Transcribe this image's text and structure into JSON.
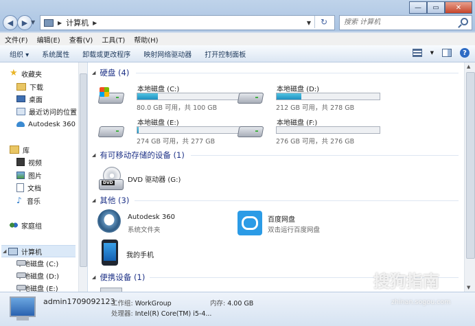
{
  "address": {
    "path": "计算机",
    "search_placeholder": "搜索 计算机"
  },
  "menu": [
    "文件(F)",
    "编辑(E)",
    "查看(V)",
    "工具(T)",
    "帮助(H)"
  ],
  "commands": [
    "组织 ▾",
    "系统属性",
    "卸载或更改程序",
    "映射网络驱动器",
    "打开控制面板"
  ],
  "nav": {
    "favorites": "收藏夹",
    "fav_items": [
      "下载",
      "桌面",
      "最近访问的位置",
      "Autodesk 360"
    ],
    "library": "库",
    "lib_items": [
      "视频",
      "图片",
      "文档",
      "音乐"
    ],
    "homegroup": "家庭组",
    "computer": "计算机",
    "computer_items": [
      "本地磁盘 (C:)",
      "本地磁盘 (D:)",
      "本地磁盘 (E:)"
    ]
  },
  "groups": {
    "hard_disks": "硬盘 (4)",
    "removable": "有可移动存储的设备 (1)",
    "other": "其他 (3)",
    "portable": "便携设备 (1)"
  },
  "drives": [
    {
      "name": "本地磁盘 (C:)",
      "free": "80.0 GB 可用，共 100 GB",
      "used_fraction": 0.2
    },
    {
      "name": "本地磁盘 (D:)",
      "free": "212 GB 可用，共 278 GB",
      "used_fraction": 0.24
    },
    {
      "name": "本地磁盘 (E:)",
      "free": "274 GB 可用，共 277 GB",
      "used_fraction": 0.01
    },
    {
      "name": "本地磁盘 (F:)",
      "free": "276 GB 可用，共 276 GB",
      "used_fraction": 0.0
    }
  ],
  "dvd": {
    "name": "DVD 驱动器 (G:)"
  },
  "other_items": {
    "autodesk": {
      "name": "Autodesk 360",
      "sub": "系统文件夹"
    },
    "baidu": {
      "name": "百度网盘",
      "sub": "双击运行百度网盘"
    },
    "phone": {
      "name": "我的手机"
    }
  },
  "details": {
    "name": "admin1709092123",
    "workgroup_label": "工作组:",
    "workgroup": "WorkGroup",
    "memory_label": "内存:",
    "memory": "4.00 GB",
    "cpu_label": "处理器:",
    "cpu": "Intel(R) Core(TM) i5-4..."
  },
  "watermark": {
    "text": "搜狗指南",
    "url": "zhinan.sogou.com"
  },
  "colors": {
    "accent": "#1e3287",
    "bar_fill": "#1e8fc0"
  }
}
